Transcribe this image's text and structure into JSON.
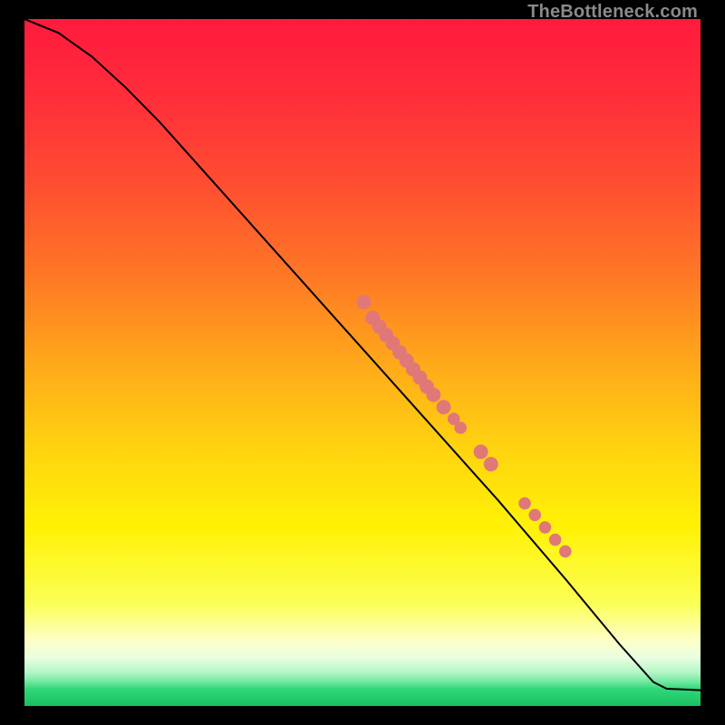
{
  "watermark": "TheBottleneck.com",
  "chart_data": {
    "type": "line",
    "title": "",
    "xlabel": "",
    "ylabel": "",
    "xlim": [
      0,
      100
    ],
    "ylim": [
      0,
      100
    ],
    "gradient_stops": [
      {
        "offset": 0.0,
        "color": "#ff1a3d"
      },
      {
        "offset": 0.12,
        "color": "#ff2f3a"
      },
      {
        "offset": 0.25,
        "color": "#ff5030"
      },
      {
        "offset": 0.38,
        "color": "#ff7a25"
      },
      {
        "offset": 0.5,
        "color": "#ffa81a"
      },
      {
        "offset": 0.62,
        "color": "#ffd210"
      },
      {
        "offset": 0.74,
        "color": "#fff205"
      },
      {
        "offset": 0.85,
        "color": "#fbff55"
      },
      {
        "offset": 0.905,
        "color": "#fdffc8"
      },
      {
        "offset": 0.93,
        "color": "#e8ffe0"
      },
      {
        "offset": 0.952,
        "color": "#b0f5c5"
      },
      {
        "offset": 0.965,
        "color": "#6ee8a0"
      },
      {
        "offset": 0.975,
        "color": "#32d87a"
      },
      {
        "offset": 1.0,
        "color": "#18c060"
      }
    ],
    "line_points": [
      {
        "x": 0.0,
        "y": 100.0
      },
      {
        "x": 5.0,
        "y": 98.0
      },
      {
        "x": 10.0,
        "y": 94.5
      },
      {
        "x": 15.0,
        "y": 90.0
      },
      {
        "x": 20.0,
        "y": 85.0
      },
      {
        "x": 30.0,
        "y": 74.0
      },
      {
        "x": 40.0,
        "y": 63.0
      },
      {
        "x": 50.0,
        "y": 52.0
      },
      {
        "x": 60.0,
        "y": 41.0
      },
      {
        "x": 70.0,
        "y": 30.0
      },
      {
        "x": 80.0,
        "y": 18.5
      },
      {
        "x": 88.0,
        "y": 9.0
      },
      {
        "x": 93.0,
        "y": 3.5
      },
      {
        "x": 95.0,
        "y": 2.5
      },
      {
        "x": 100.0,
        "y": 2.3
      }
    ],
    "scatter_points": [
      {
        "x": 50.2,
        "y": 58.8
      },
      {
        "x": 51.5,
        "y": 56.5
      },
      {
        "x": 52.5,
        "y": 55.2
      },
      {
        "x": 53.5,
        "y": 54.0
      },
      {
        "x": 54.5,
        "y": 52.8
      },
      {
        "x": 55.5,
        "y": 51.5
      },
      {
        "x": 56.5,
        "y": 50.3
      },
      {
        "x": 57.5,
        "y": 49.0
      },
      {
        "x": 58.5,
        "y": 47.8
      },
      {
        "x": 59.5,
        "y": 46.5
      },
      {
        "x": 60.5,
        "y": 45.3
      },
      {
        "x": 62.0,
        "y": 43.5
      },
      {
        "x": 63.5,
        "y": 41.8
      },
      {
        "x": 64.5,
        "y": 40.5
      },
      {
        "x": 67.5,
        "y": 37.0
      },
      {
        "x": 69.0,
        "y": 35.2
      },
      {
        "x": 74.0,
        "y": 29.5
      },
      {
        "x": 75.5,
        "y": 27.8
      },
      {
        "x": 77.0,
        "y": 26.0
      },
      {
        "x": 78.5,
        "y": 24.2
      },
      {
        "x": 80.0,
        "y": 22.5
      }
    ],
    "marker_color": "#e07878",
    "marker_radius_large": 8.0,
    "marker_radius_small": 6.8,
    "line_color": "#000000",
    "line_width": 2.0
  }
}
